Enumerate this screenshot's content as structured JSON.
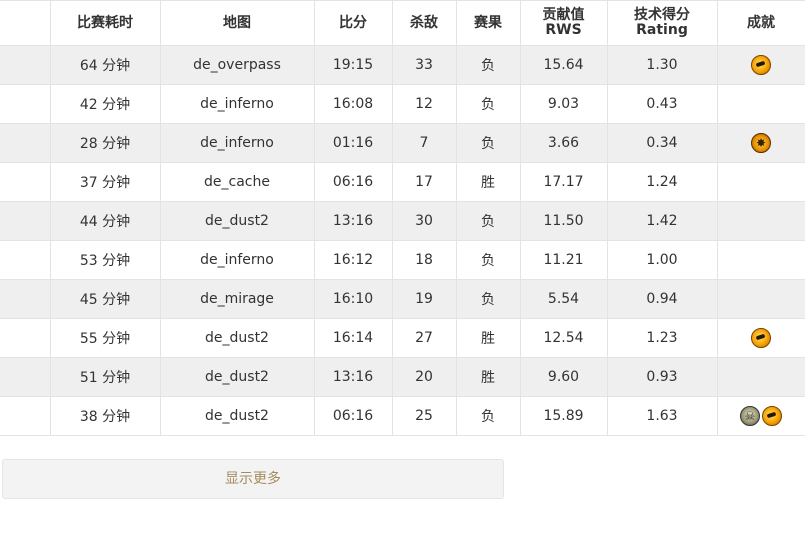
{
  "table": {
    "headers": {
      "duration": "比赛耗时",
      "map": "地图",
      "score": "比分",
      "kills": "杀敌",
      "result": "赛果",
      "rws_line1": "贡献值",
      "rws_line2": "RWS",
      "rating_line1": "技术得分",
      "rating_line2": "Rating",
      "achievements": "成就"
    },
    "rows": [
      {
        "duration": "64 分钟",
        "map": "de_overpass",
        "score": "19:15",
        "kills": "33",
        "result": "负",
        "rws": "15.64",
        "rating": "1.30",
        "badges": [
          "fire-medal-icon"
        ]
      },
      {
        "duration": "42 分钟",
        "map": "de_inferno",
        "score": "16:08",
        "kills": "12",
        "result": "负",
        "rws": "9.03",
        "rating": "0.43",
        "badges": []
      },
      {
        "duration": "28 分钟",
        "map": "de_inferno",
        "score": "01:16",
        "kills": "7",
        "result": "负",
        "rws": "3.66",
        "rating": "0.34",
        "badges": [
          "star-medal-icon"
        ]
      },
      {
        "duration": "37 分钟",
        "map": "de_cache",
        "score": "06:16",
        "kills": "17",
        "result": "胜",
        "rws": "17.17",
        "rating": "1.24",
        "badges": []
      },
      {
        "duration": "44 分钟",
        "map": "de_dust2",
        "score": "13:16",
        "kills": "30",
        "result": "负",
        "rws": "11.50",
        "rating": "1.42",
        "badges": []
      },
      {
        "duration": "53 分钟",
        "map": "de_inferno",
        "score": "16:12",
        "kills": "18",
        "result": "负",
        "rws": "11.21",
        "rating": "1.00",
        "badges": []
      },
      {
        "duration": "45 分钟",
        "map": "de_mirage",
        "score": "16:10",
        "kills": "19",
        "result": "负",
        "rws": "5.54",
        "rating": "0.94",
        "badges": []
      },
      {
        "duration": "55 分钟",
        "map": "de_dust2",
        "score": "16:14",
        "kills": "27",
        "result": "胜",
        "rws": "12.54",
        "rating": "1.23",
        "badges": [
          "fire-medal-icon"
        ]
      },
      {
        "duration": "51 分钟",
        "map": "de_dust2",
        "score": "13:16",
        "kills": "20",
        "result": "胜",
        "rws": "9.60",
        "rating": "0.93",
        "badges": []
      },
      {
        "duration": "38 分钟",
        "map": "de_dust2",
        "score": "06:16",
        "kills": "25",
        "result": "负",
        "rws": "15.89",
        "rating": "1.63",
        "badges": [
          "skull-medal-icon",
          "fire-medal-icon"
        ]
      }
    ]
  },
  "show_more_label": "显示更多",
  "colors": {
    "stripe": "#efefef",
    "border": "#e3e3e3",
    "show_more_text": "#a48c5e"
  }
}
